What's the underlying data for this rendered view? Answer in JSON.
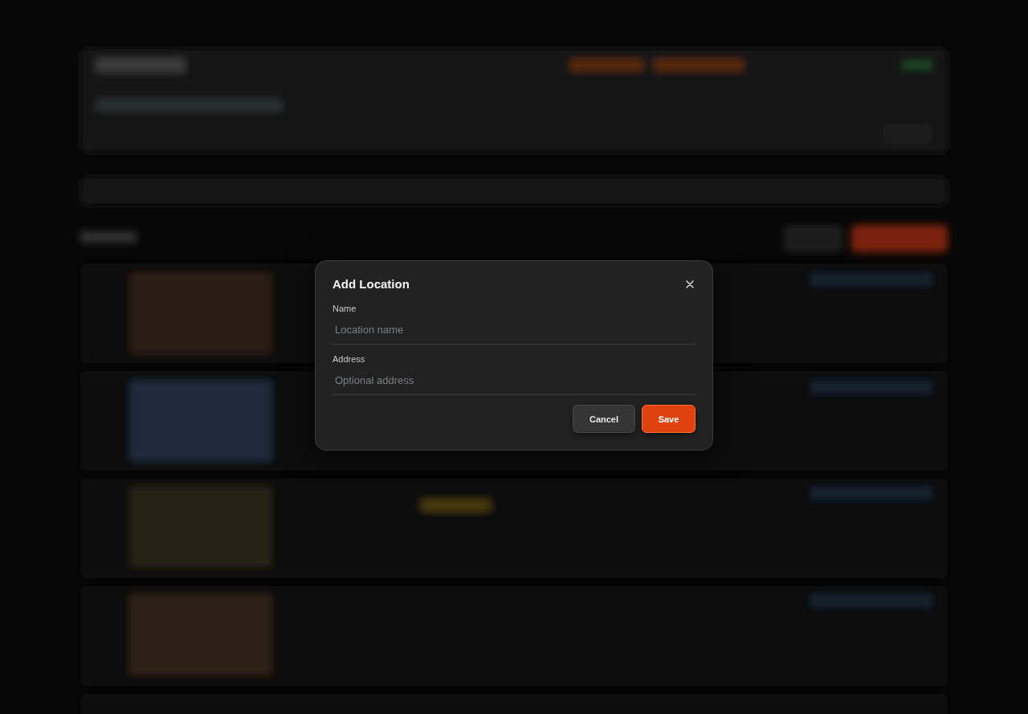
{
  "dialog": {
    "title": "Add Location",
    "fields": [
      {
        "label": "Name",
        "placeholder": "Location name"
      },
      {
        "label": "Address",
        "placeholder": "Optional address"
      }
    ],
    "buttons": [
      {
        "label": "Cancel",
        "kind": "secondary"
      },
      {
        "label": "Save",
        "kind": "primary"
      }
    ]
  }
}
